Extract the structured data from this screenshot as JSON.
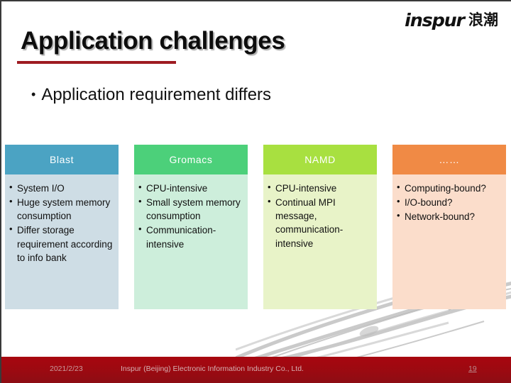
{
  "slide": {
    "title": "Application challenges",
    "lead_bullet": "Application requirement differs",
    "bullet_glyph": "•"
  },
  "logo": {
    "latin": "inspur",
    "cjk": "浪潮"
  },
  "colors": {
    "title_rule": "#9e1b22",
    "footer_bar": "#9e0b12",
    "blast_header": "#4ba3c3",
    "blast_body": "#cedde5",
    "gromacs_header": "#4cd07a",
    "gromacs_body": "#cdeedb",
    "namd_header": "#a8e040",
    "namd_body": "#e8f3c8",
    "other_header": "#f08a45",
    "other_body": "#fbddcb"
  },
  "columns": [
    {
      "name": "blast",
      "header": "Blast",
      "header_color": "#4ba3c3",
      "body_color": "#cedde5",
      "items": [
        "System I/O",
        "Huge system memory consumption",
        "Differ storage requirement according to info bank"
      ]
    },
    {
      "name": "gromacs",
      "header": "Gromacs",
      "header_color": "#4cd07a",
      "body_color": "#cdeedb",
      "items": [
        "CPU-intensive",
        "Small system memory consumption",
        "Communication-intensive"
      ]
    },
    {
      "name": "namd",
      "header": "NAMD",
      "header_color": "#a8e040",
      "body_color": "#e8f3c8",
      "items": [
        "CPU-intensive",
        "Continual MPI message, communication-intensive"
      ]
    },
    {
      "name": "other",
      "header": "……",
      "header_color": "#f08a45",
      "body_color": "#fbddcb",
      "items": [
        "Computing-bound?",
        "I/O-bound?",
        "Network-bound?"
      ]
    }
  ],
  "footer": {
    "date": "2021/2/23",
    "company": "Inspur (Beijing) Electronic Information Industry Co., Ltd.",
    "page": "19"
  }
}
